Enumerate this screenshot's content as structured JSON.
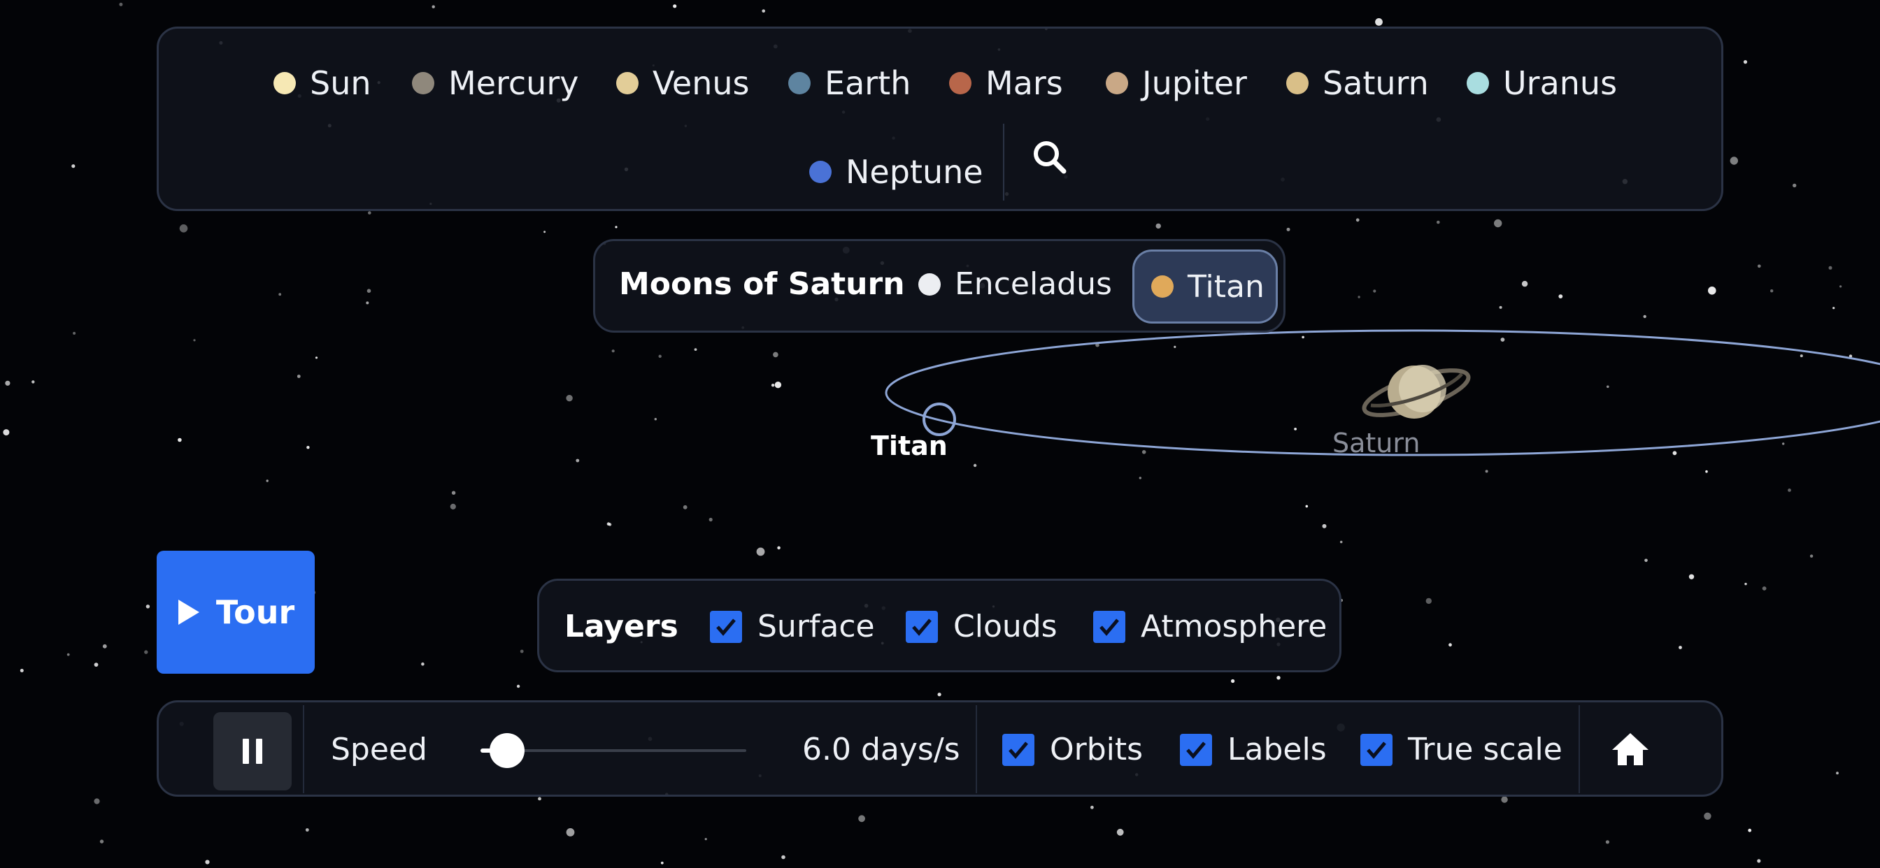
{
  "planets": [
    {
      "label": "Sun",
      "color": "#f6e8b4"
    },
    {
      "label": "Mercury",
      "color": "#8f887c"
    },
    {
      "label": "Venus",
      "color": "#e2cd98"
    },
    {
      "label": "Earth",
      "color": "#5e84a0"
    },
    {
      "label": "Mars",
      "color": "#b8664a"
    },
    {
      "label": "Jupiter",
      "color": "#c9a886"
    },
    {
      "label": "Saturn",
      "color": "#d9bf88"
    },
    {
      "label": "Uranus",
      "color": "#a9dde0"
    },
    {
      "label": "Neptune",
      "color": "#4a72d6"
    }
  ],
  "search": {
    "icon": "search-icon"
  },
  "moons": {
    "title": "Moons of Saturn",
    "items": [
      {
        "label": "Enceladus",
        "color": "#eceef2",
        "selected": false
      },
      {
        "label": "Titan",
        "color": "#e0a95a",
        "selected": true
      }
    ]
  },
  "scene": {
    "titan_label": "Titan",
    "saturn_label": "Saturn",
    "orbit_color": "#8ea6d6"
  },
  "tour": {
    "label": "Tour",
    "icon": "play-icon"
  },
  "layers": {
    "title": "Layers",
    "items": [
      {
        "label": "Surface",
        "checked": true
      },
      {
        "label": "Clouds",
        "checked": true
      },
      {
        "label": "Atmosphere",
        "checked": true
      }
    ]
  },
  "controls": {
    "pause_icon": "pause-icon",
    "speed_label": "Speed",
    "speed_value": "6.0 days/s",
    "speed_slider_fraction": 0.05,
    "toggles": [
      {
        "label": "Orbits",
        "checked": true
      },
      {
        "label": "Labels",
        "checked": true
      },
      {
        "label": "True scale",
        "checked": true
      }
    ],
    "home_icon": "home-icon"
  },
  "colors": {
    "accent": "#2b6ef2",
    "panel_bg": "#10131c",
    "panel_border": "#2b3345",
    "selected_bg": "#2d3a57"
  }
}
